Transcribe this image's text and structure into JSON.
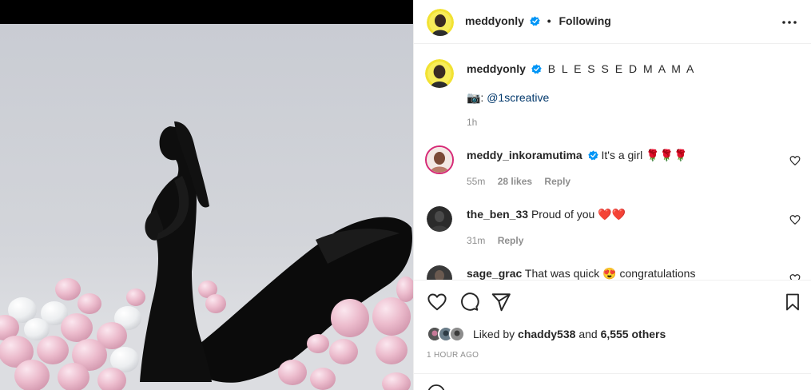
{
  "post": {
    "author": "meddyonly",
    "follow_sep": "•",
    "follow_state": "Following",
    "caption": "B L E S S E D M A M A",
    "credit_prefix": "📷:",
    "credit_handle": "@1screative",
    "caption_time": "1h"
  },
  "comments": [
    {
      "user": "meddy_inkoramutima",
      "verified": true,
      "text": "It's a girl 🌹🌹🌹",
      "time": "55m",
      "likes": "28 likes",
      "reply": "Reply"
    },
    {
      "user": "the_ben_33",
      "verified": false,
      "text": "Proud of you ❤️❤️",
      "time": "31m",
      "likes": "",
      "reply": "Reply"
    },
    {
      "user": "sage_grac",
      "verified": false,
      "text": "That was quick 😍 congratulations",
      "time": "",
      "likes": "",
      "reply": ""
    }
  ],
  "likes": {
    "prefix": "Liked by",
    "user": "chaddy538",
    "middle": "and",
    "others": "6,555 others"
  },
  "post_time": "1 HOUR AGO",
  "icons": {
    "more": "more-horizontal-icon",
    "like": "heart-icon",
    "comment": "comment-bubble-icon",
    "share": "paper-plane-icon",
    "save": "bookmark-icon",
    "verified": "verified-badge-icon"
  },
  "colors": {
    "link": "#00376b",
    "verified": "#0095f6",
    "muted": "#8e8e8e",
    "text": "#262626"
  }
}
